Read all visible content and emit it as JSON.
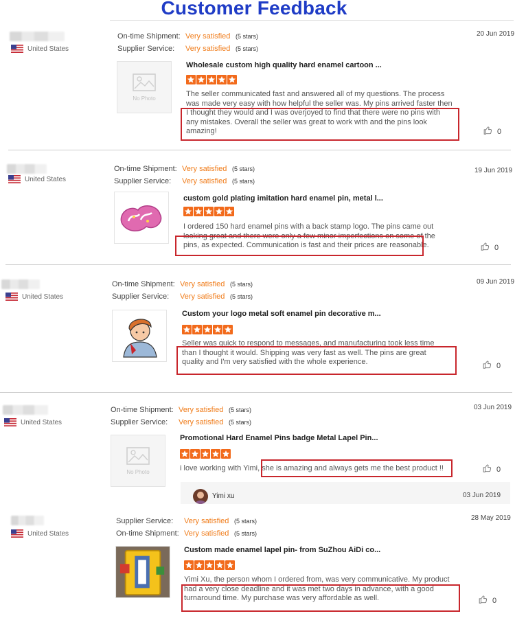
{
  "page": {
    "title": "Customer Feedback"
  },
  "common": {
    "country": "United States",
    "no_photo": "No Photo",
    "stars_text": "(5 stars)"
  },
  "reviews": [
    {
      "ratings": [
        {
          "label": "On-time Shipment:",
          "value": "Very satisfied"
        },
        {
          "label": "Supplier Service:",
          "value": "Very satisfied"
        }
      ],
      "date": "20 Jun 2019",
      "product_title": "Wholesale custom high quality hard enamel cartoon ...",
      "star_count": 5,
      "comment": "The seller communicated fast and answered all of my questions. The process was made very easy with how helpful the seller was. My pins arrived faster then I thought they would and I was overjoyed to find that there were no pins with any mistakes. Overall the seller was great to work with and the pins look amazing!",
      "likes": "0",
      "image": "no-photo"
    },
    {
      "ratings": [
        {
          "label": "On-time Shipment:",
          "value": "Very satisfied"
        },
        {
          "label": "Supplier Service:",
          "value": "Very satisfied"
        }
      ],
      "date": "19 Jun 2019",
      "product_title": "custom gold plating imitation hard enamel pin, metal l...",
      "star_count": 5,
      "comment": "I ordered 150 hard enamel pins with a back stamp logo. The pins came out looking great and there were only a few minor imperfections on some of the pins, as expected. Communication is fast and their prices are reasonable.",
      "likes": "0",
      "image": "pink-pin"
    },
    {
      "ratings": [
        {
          "label": "On-time Shipment:",
          "value": "Very satisfied"
        },
        {
          "label": "Supplier Service:",
          "value": "Very satisfied"
        }
      ],
      "date": "09 Jun 2019",
      "product_title": "Custom your logo metal soft enamel pin decorative m...",
      "star_count": 5,
      "comment": "Seller was quick to respond to messages, and manufacturing took less time than I thought it would. Shipping was very fast as well. The pins are great quality and I'm very satisfied with the whole experience.",
      "likes": "0",
      "image": "character-pin"
    },
    {
      "ratings": [
        {
          "label": "On-time Shipment:",
          "value": "Very satisfied"
        },
        {
          "label": "Supplier Service:",
          "value": "Very satisfied"
        }
      ],
      "date": "03 Jun 2019",
      "product_title": "Promotional Hard Enamel Pins badge Metal Lapel Pin...",
      "star_count": 5,
      "comment": "i love working with Yimi, she is amazing and always gets me the best product !!",
      "likes": "0",
      "image": "no-photo",
      "reply": {
        "name": "Yimi xu",
        "date": "03 Jun 2019"
      }
    },
    {
      "ratings": [
        {
          "label": "Supplier Service:",
          "value": "Very satisfied"
        },
        {
          "label": "On-time Shipment:",
          "value": "Very satisfied"
        }
      ],
      "date": "28 May 2019",
      "product_title": "Custom made enamel lapel pin- from SuZhou AiDi co...",
      "star_count": 5,
      "comment": "Yimi Xu, the person whom I ordered from, was very communicative. My product had a very close deadline and it was met two days in advance, with a good turnaround time. My purchase was very affordable as well.",
      "likes": "0",
      "image": "yellow-pin"
    }
  ],
  "colors": {
    "title": "#1f3cc6",
    "rating_value": "#f07c1a",
    "star": "#f26a1b",
    "highlight": "#c8262c"
  }
}
